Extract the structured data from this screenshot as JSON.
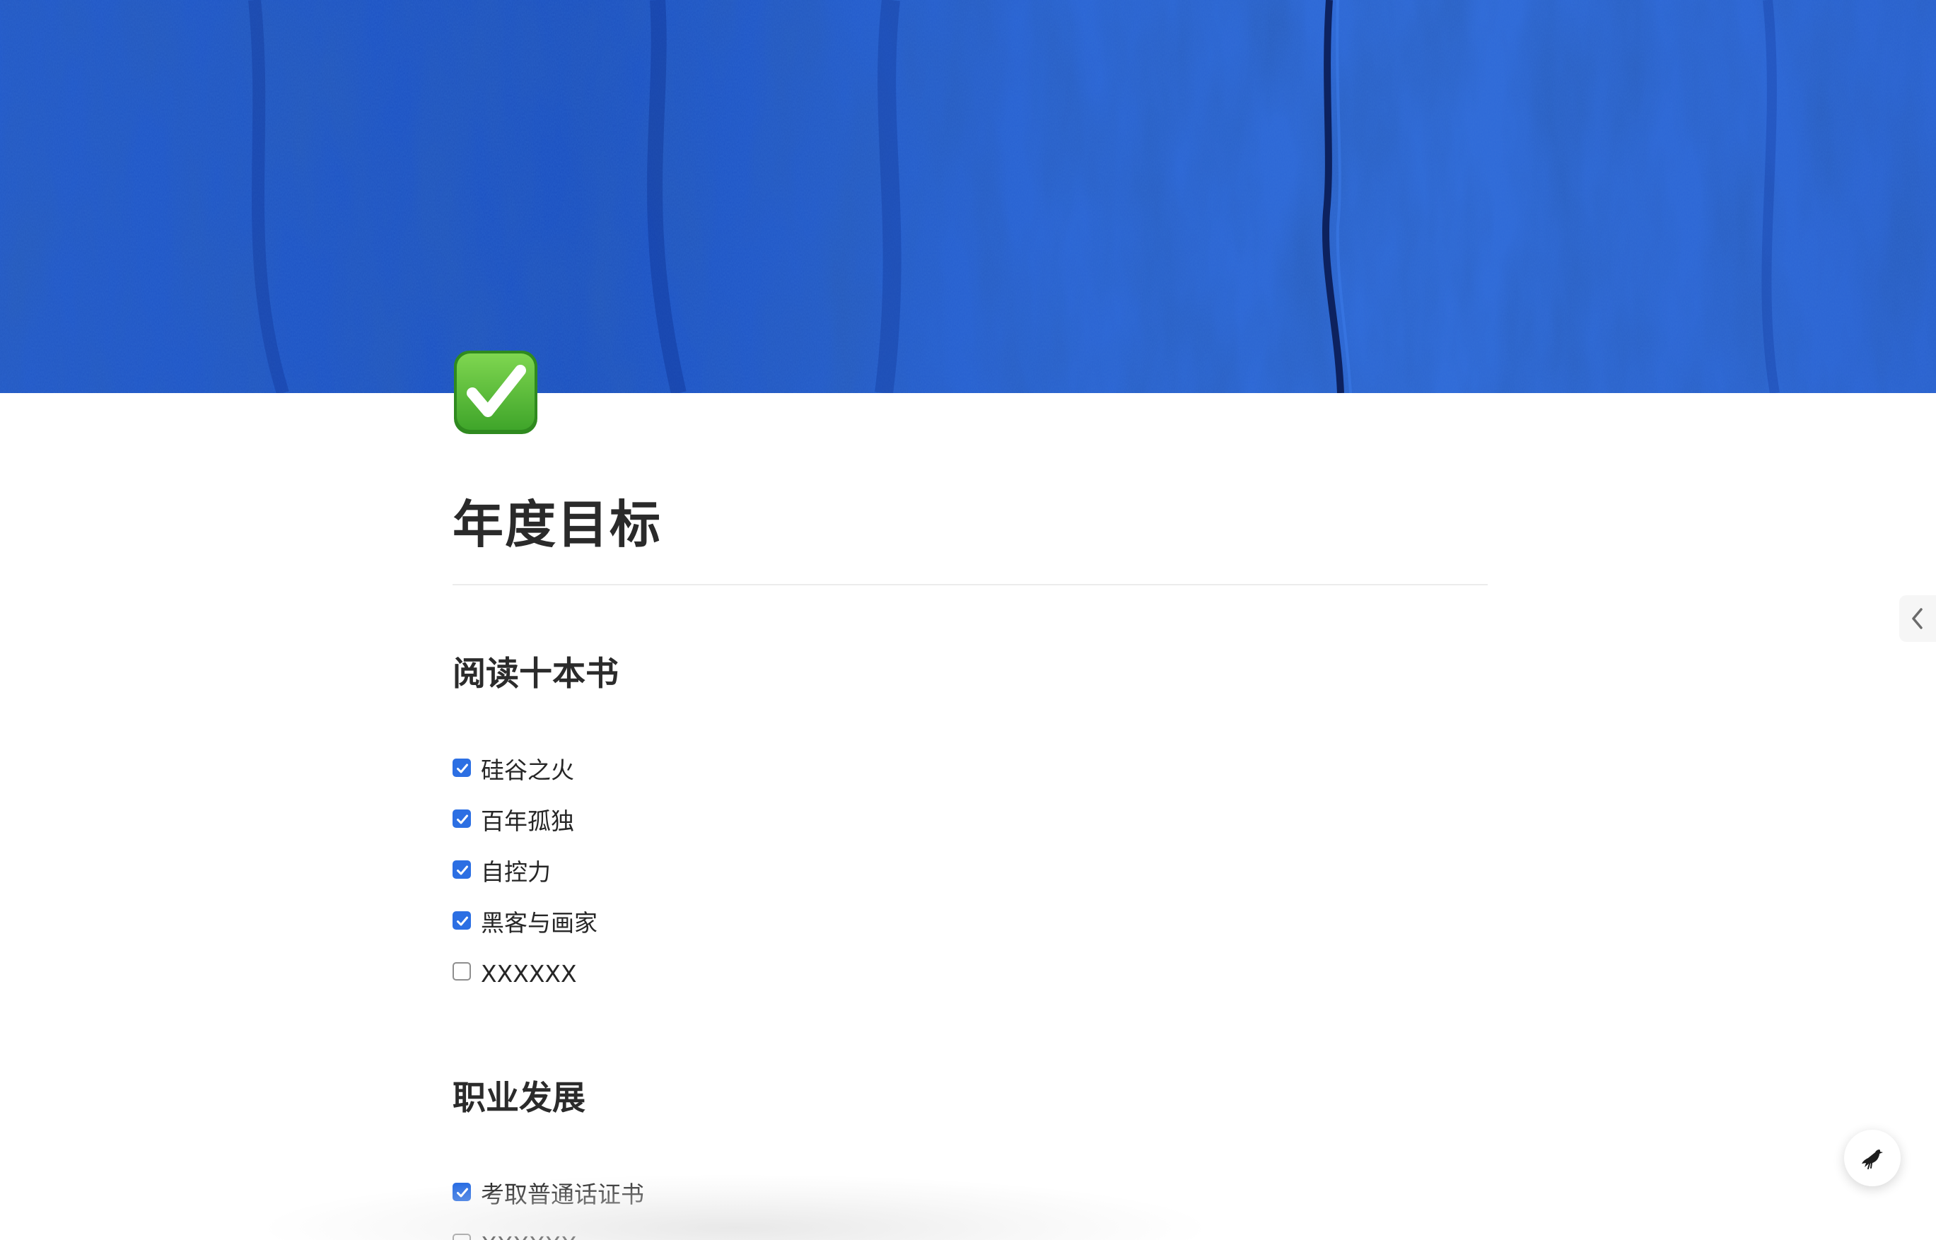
{
  "cover": {
    "description_color": "#1a4fc4"
  },
  "page_icon": {
    "icon": "check-mark-button-icon",
    "color": "#4caf2f"
  },
  "page": {
    "title": "年度目标"
  },
  "sections": [
    {
      "heading": "阅读十本书",
      "items": [
        {
          "label": "硅谷之火",
          "checked": true
        },
        {
          "label": "百年孤独",
          "checked": true
        },
        {
          "label": "自控力",
          "checked": true
        },
        {
          "label": "黑客与画家",
          "checked": true
        },
        {
          "label": "XXXXXX",
          "checked": false
        }
      ]
    },
    {
      "heading": "职业发展",
      "items": [
        {
          "label": "考取普通话证书",
          "checked": true
        },
        {
          "label": "XXXXXX",
          "checked": false
        }
      ]
    }
  ],
  "side_tab": {
    "icon": "chevron-left-icon"
  },
  "floating_button": {
    "icon": "bird-icon"
  },
  "colors": {
    "accent": "#2c6fe3",
    "text": "#2b2b2b",
    "divider": "#ececec"
  }
}
